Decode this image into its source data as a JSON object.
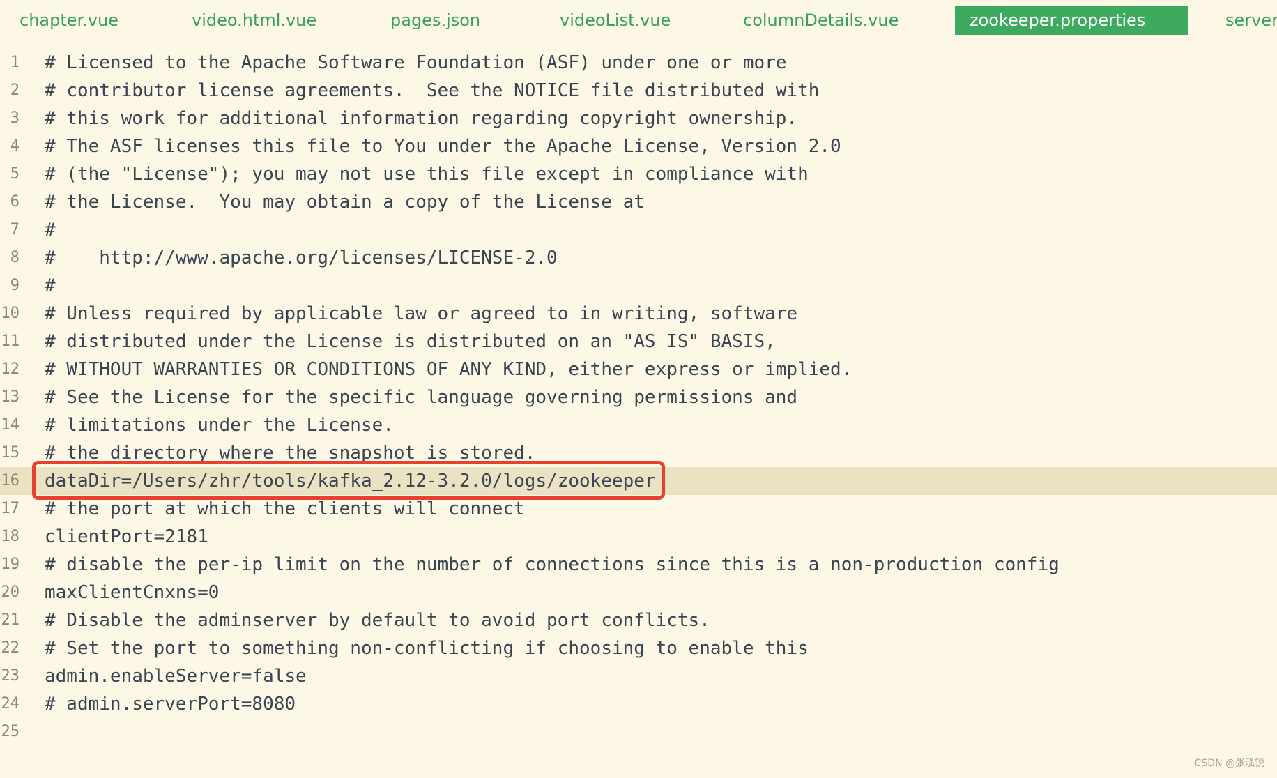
{
  "tabs": [
    {
      "label": "chapter.vue",
      "active": false
    },
    {
      "label": "video.html.vue",
      "active": false
    },
    {
      "label": "pages.json",
      "active": false
    },
    {
      "label": "videoList.vue",
      "active": false
    },
    {
      "label": "columnDetails.vue",
      "active": false
    },
    {
      "label": "zookeeper.properties",
      "active": true
    },
    {
      "label": "server",
      "active": false
    }
  ],
  "editor": {
    "highlighted_line": 16,
    "lines": [
      {
        "num": "1",
        "text": "# Licensed to the Apache Software Foundation (ASF) under one or more"
      },
      {
        "num": "2",
        "text": "# contributor license agreements.  See the NOTICE file distributed with"
      },
      {
        "num": "3",
        "text": "# this work for additional information regarding copyright ownership."
      },
      {
        "num": "4",
        "text": "# The ASF licenses this file to You under the Apache License, Version 2.0"
      },
      {
        "num": "5",
        "text": "# (the \"License\"); you may not use this file except in compliance with"
      },
      {
        "num": "6",
        "text": "# the License.  You may obtain a copy of the License at"
      },
      {
        "num": "7",
        "text": "#"
      },
      {
        "num": "8",
        "text": "#    http://www.apache.org/licenses/LICENSE-2.0"
      },
      {
        "num": "9",
        "text": "#"
      },
      {
        "num": "10",
        "text": "# Unless required by applicable law or agreed to in writing, software"
      },
      {
        "num": "11",
        "text": "# distributed under the License is distributed on an \"AS IS\" BASIS,"
      },
      {
        "num": "12",
        "text": "# WITHOUT WARRANTIES OR CONDITIONS OF ANY KIND, either express or implied."
      },
      {
        "num": "13",
        "text": "# See the License for the specific language governing permissions and"
      },
      {
        "num": "14",
        "text": "# limitations under the License."
      },
      {
        "num": "15",
        "text": "# the directory where the snapshot is stored."
      },
      {
        "num": "16",
        "text": "dataDir=/Users/zhr/tools/kafka_2.12-3.2.0/logs/zookeeper"
      },
      {
        "num": "17",
        "text": "# the port at which the clients will connect"
      },
      {
        "num": "18",
        "text": "clientPort=2181"
      },
      {
        "num": "19",
        "text": "# disable the per-ip limit on the number of connections since this is a non-production config"
      },
      {
        "num": "20",
        "text": "maxClientCnxns=0"
      },
      {
        "num": "21",
        "text": "# Disable the adminserver by default to avoid port conflicts."
      },
      {
        "num": "22",
        "text": "# Set the port to something non-conflicting if choosing to enable this"
      },
      {
        "num": "23",
        "text": "admin.enableServer=false"
      },
      {
        "num": "24",
        "text": "# admin.serverPort=8080"
      },
      {
        "num": "25",
        "text": ""
      }
    ]
  },
  "watermark": "CSDN @张泓锐",
  "colors": {
    "background": "#fdf8e6",
    "tab_text": "#3aa25c",
    "active_tab": "#3eaa5f",
    "highlight_line": "#ebe2c4",
    "callout_border": "#e8402f"
  }
}
